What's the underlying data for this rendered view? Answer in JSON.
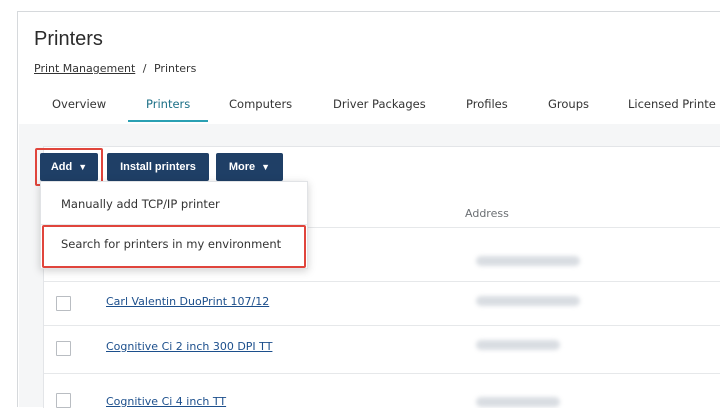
{
  "page": {
    "title": "Printers"
  },
  "breadcrumb": {
    "parent": "Print Management",
    "separator": "/",
    "current": "Printers"
  },
  "tabs": [
    {
      "label": "Overview"
    },
    {
      "label": "Printers",
      "active": true
    },
    {
      "label": "Computers"
    },
    {
      "label": "Driver Packages"
    },
    {
      "label": "Profiles"
    },
    {
      "label": "Groups"
    },
    {
      "label": "Licensed Printe"
    }
  ],
  "toolbar": {
    "add_label": "Add",
    "install_label": "Install printers",
    "more_label": "More",
    "caret": "▼"
  },
  "add_menu": {
    "items": [
      {
        "label": "Manually add TCP/IP printer"
      },
      {
        "label": "Search for printers in my environment",
        "highlighted": true
      }
    ]
  },
  "table": {
    "columns": {
      "address": "Address"
    },
    "rows": [
      {
        "name": "",
        "address": ""
      },
      {
        "name": "Carl Valentin DuoPrint 107/12",
        "address": ""
      },
      {
        "name": "Cognitive Ci 2 inch 300 DPI TT",
        "address": ""
      },
      {
        "name": "Cognitive Ci 4 inch TT",
        "address": ""
      }
    ]
  },
  "colors": {
    "primary_button": "#1f3f66",
    "highlight": "#e0453c",
    "active_tab": "#2aa0b3",
    "link": "#1c4f8c"
  }
}
